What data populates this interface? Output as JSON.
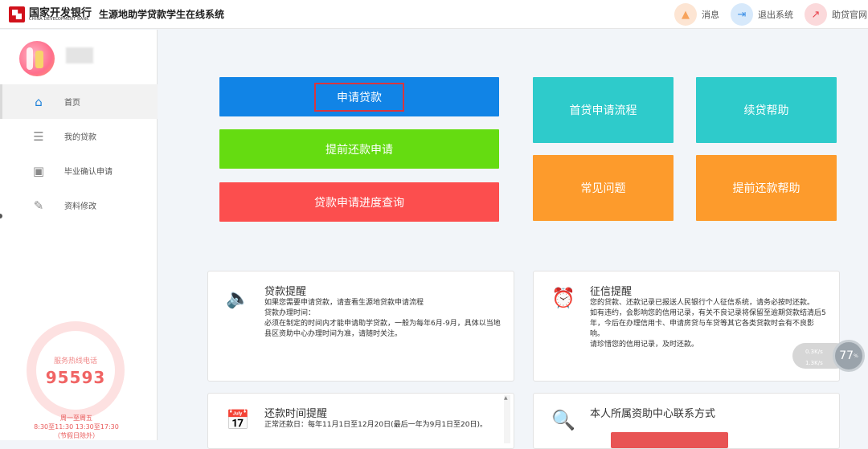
{
  "header": {
    "bank_name_cn": "国家开发银行",
    "bank_name_en": "CHINA DEVELOPMENT BANK",
    "system_title": "生源地助学贷款学生在线系统",
    "actions": [
      {
        "label": "消息",
        "icon": "bell-icon",
        "color": "#f7a35c",
        "bg": "#fde5d3"
      },
      {
        "label": "退出系统",
        "icon": "logout-icon",
        "color": "#3a8ee6",
        "bg": "#d7e9fb"
      },
      {
        "label": "助贷官网",
        "icon": "external-link-icon",
        "color": "#e8414b",
        "bg": "#fbd9db"
      }
    ]
  },
  "sidebar": {
    "username": "",
    "nav": [
      {
        "label": "首页",
        "icon": "home-icon",
        "active": true
      },
      {
        "label": "我的贷款",
        "icon": "list-icon",
        "active": false
      },
      {
        "label": "毕业确认申请",
        "icon": "inbox-icon",
        "active": false
      },
      {
        "label": "资料修改",
        "icon": "edit-icon",
        "active": false
      }
    ],
    "hotline": {
      "label": "服务热线电话",
      "number": "95593",
      "hours_line1": "周一至周五",
      "hours_line2": "8:30至11:30 13:30至17:30",
      "hours_line3": "（节假日除外）"
    }
  },
  "main": {
    "buttons": {
      "apply": "申请贷款",
      "prepay_apply": "提前还款申请",
      "progress": "贷款申请进度查询",
      "first_loan_flow": "首贷申请流程",
      "renew_help": "续贷帮助",
      "faq": "常见问题",
      "prepay_help": "提前还款帮助"
    },
    "cards": {
      "loan_reminder": {
        "title": "贷款提醒",
        "lines": [
          "如果您需要申请贷款，请查看生源地贷款申请流程",
          "贷款办理时间：",
          "必须在制定的时间内才能申请助学贷款，一般为每年6月-9月，具体以当地县区资助中心办理时间为准，请随时关注。"
        ]
      },
      "credit_reminder": {
        "title": "征信提醒",
        "lines": [
          "您的贷款、还款记录已报送人民银行个人征信系统，请务必按时还款。",
          "如有违约，会影响您的信用记录，有关不良记录将保留至逾期贷款结清后5年，今后在办理信用卡、申请房贷与车贷等其它各类贷款时会有不良影响。",
          "请珍惜您的信用记录，及时还款。"
        ]
      },
      "repay_reminder": {
        "title": "还款时间提醒",
        "lines": [
          "正常还款日：每年11月1日至12月20日(最后一年为9月1日至20日)。"
        ]
      },
      "contact": {
        "title": "本人所属资助中心联系方式"
      }
    }
  },
  "net_speed": {
    "up": "0.3K/s",
    "down": "1.3K/s",
    "percent": "77",
    "unit": "%"
  }
}
